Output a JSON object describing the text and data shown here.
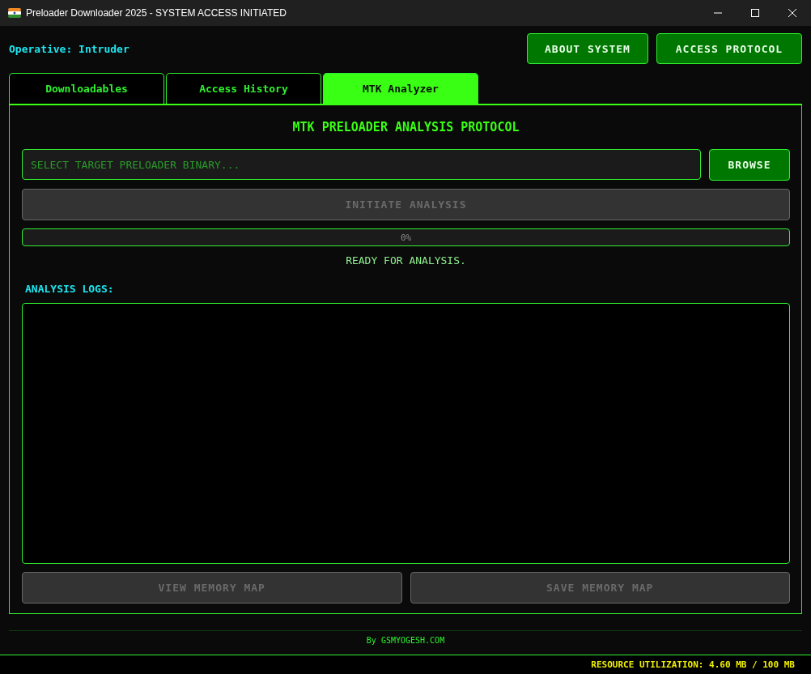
{
  "window": {
    "title": "Preloader Downloader 2025 - SYSTEM ACCESS INITIATED"
  },
  "header": {
    "operative": "Operative: Intruder",
    "buttons": [
      {
        "label": "ABOUT SYSTEM"
      },
      {
        "label": "ACCESS PROTOCOL"
      }
    ]
  },
  "tabs": [
    {
      "label": "Downloadables",
      "selected": false
    },
    {
      "label": "Access History",
      "selected": false
    },
    {
      "label": "MTK Analyzer",
      "selected": true
    }
  ],
  "panel": {
    "heading": "MTK PRELOADER ANALYSIS PROTOCOL",
    "file_field": {
      "placeholder": "SELECT TARGET PRELOADER BINARY..."
    },
    "browse_button": {
      "label": "BROWSE",
      "disabled": false
    },
    "analyze_button": {
      "label": "INITIATE ANALYSIS",
      "disabled": true
    },
    "progress": {
      "level": 0,
      "reading": "0%"
    },
    "status": "READY FOR ANALYSIS.",
    "logs_label": "ANALYSIS LOGS:",
    "bottom_buttons": [
      {
        "label": "VIEW MEMORY MAP",
        "disabled": true
      },
      {
        "label": "SAVE MEMORY MAP",
        "disabled": true
      }
    ]
  },
  "footer": "By GSMYOGESH.COM",
  "status_bar": "RESOURCE UTILIZATION: 4.60 MB / 100 MB"
}
